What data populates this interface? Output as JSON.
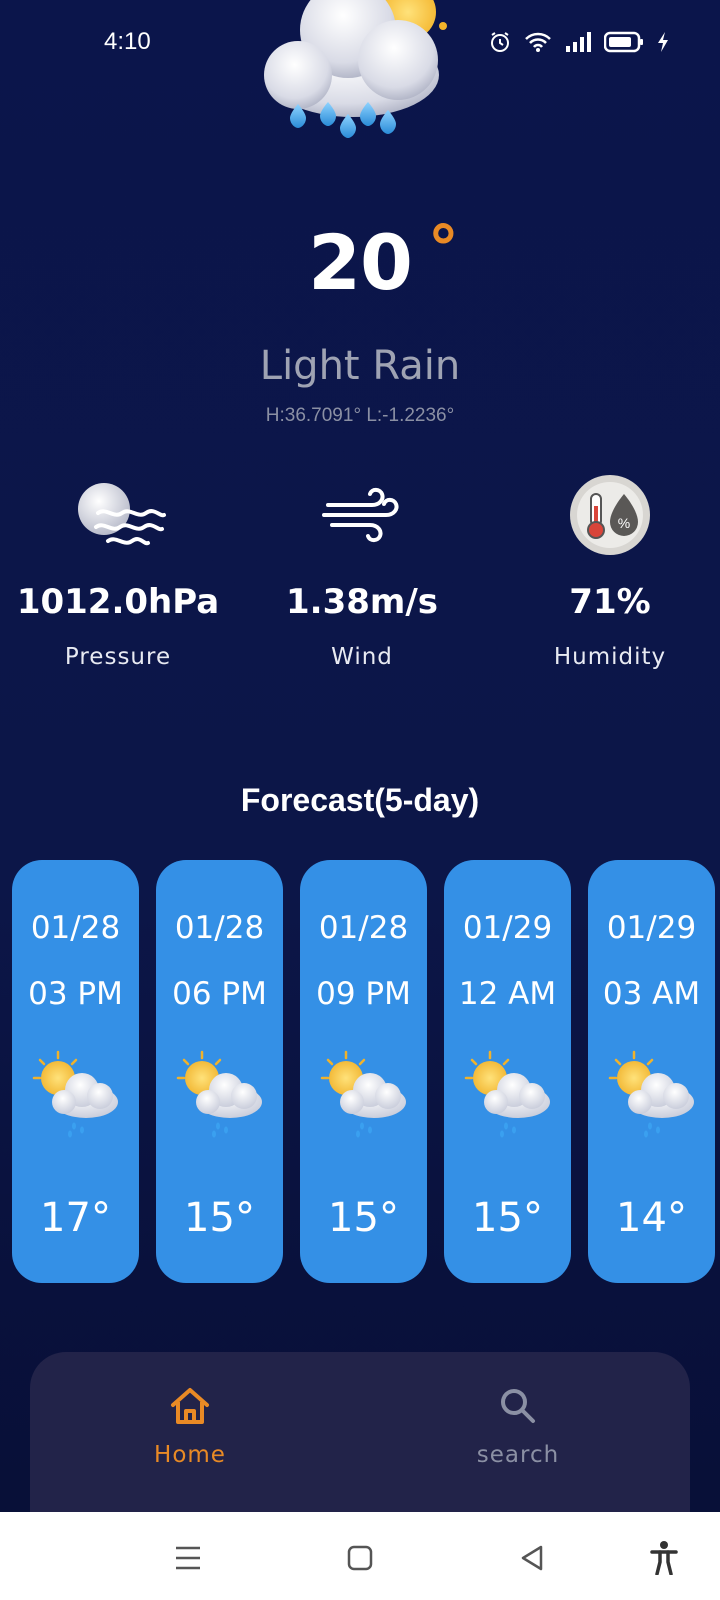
{
  "status": {
    "time": "4:10",
    "icons": [
      "alarm-icon",
      "wifi-icon",
      "signal-icon",
      "battery-icon",
      "charging-icon"
    ]
  },
  "current": {
    "icon": "sun-cloud-rain-icon",
    "temperature": "20",
    "degree_symbol": "°",
    "condition": "Light Rain",
    "coords": "H:36.7091°  L:-1.2236°"
  },
  "metrics": [
    {
      "icon": "pressure-icon",
      "value": "1012.0hPa",
      "label": "Pressure"
    },
    {
      "icon": "wind-icon",
      "value": "1.38m/s",
      "label": "Wind"
    },
    {
      "icon": "humidity-icon",
      "value": "71%",
      "label": "Humidity"
    }
  ],
  "forecast": {
    "title": "Forecast(5-day)",
    "items": [
      {
        "date": "01/28",
        "time": "03 PM",
        "icon": "partly-cloudy-rain-icon",
        "temp": "17°"
      },
      {
        "date": "01/28",
        "time": "06 PM",
        "icon": "partly-cloudy-rain-icon",
        "temp": "15°"
      },
      {
        "date": "01/28",
        "time": "09 PM",
        "icon": "partly-cloudy-rain-icon",
        "temp": "15°"
      },
      {
        "date": "01/29",
        "time": "12 AM",
        "icon": "partly-cloudy-rain-icon",
        "temp": "15°"
      },
      {
        "date": "01/29",
        "time": "03 AM",
        "icon": "partly-cloudy-rain-icon",
        "temp": "14°"
      }
    ]
  },
  "nav": {
    "home_label": "Home",
    "search_label": "search",
    "active": "home"
  },
  "colors": {
    "background": "#0b154b",
    "accent": "#e98a25",
    "card": "#3490e6",
    "nav_bg": "#222349",
    "muted": "#9fa3b3"
  },
  "system_nav": [
    "menu-icon",
    "home-square-icon",
    "back-icon",
    "accessibility-icon"
  ]
}
